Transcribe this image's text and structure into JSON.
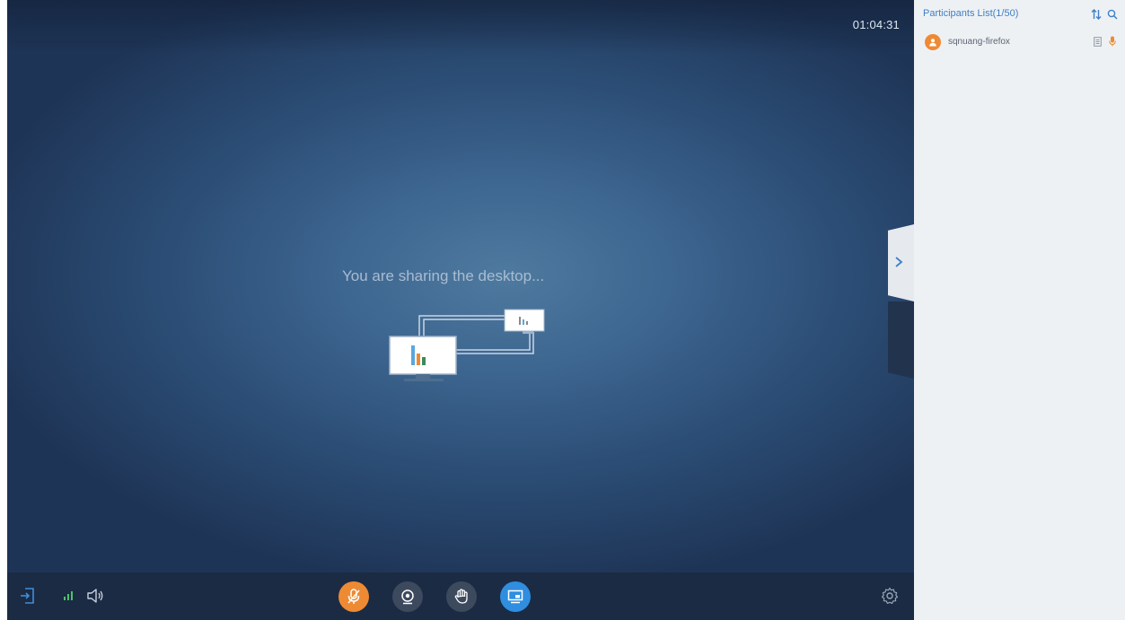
{
  "meeting": {
    "timer": "01:04:31",
    "share_message": "You are sharing the desktop..."
  },
  "participants_panel": {
    "title": "Participants List(1/50)",
    "sort_icon": "sort-icon",
    "search_icon": "search-icon",
    "participants": [
      {
        "name": "sqnuang-firefox",
        "avatar_color": "#ee8a34",
        "role_icon": "doc-icon",
        "mic_icon": "mic-icon"
      }
    ]
  },
  "bottom_bar": {
    "left_icons": [
      "exit-icon",
      "signal-icon",
      "speaker-icon"
    ],
    "center_buttons": [
      {
        "name": "mute-mic-button",
        "icon": "mic-muted-icon",
        "color": "#ee8a34"
      },
      {
        "name": "camera-button",
        "icon": "camera-icon",
        "color": "#3d4a5e"
      },
      {
        "name": "raise-hand-button",
        "icon": "hand-icon",
        "color": "#3d4a5e"
      },
      {
        "name": "screen-share-button",
        "icon": "screen-share-icon",
        "color": "#2f8ee0"
      }
    ],
    "right_icons": [
      "settings-icon"
    ]
  },
  "colors": {
    "accent_blue": "#3f7fc6",
    "accent_orange": "#ee8a34",
    "bar_bg": "#1b2b44",
    "panel_bg": "#eef1f4"
  }
}
